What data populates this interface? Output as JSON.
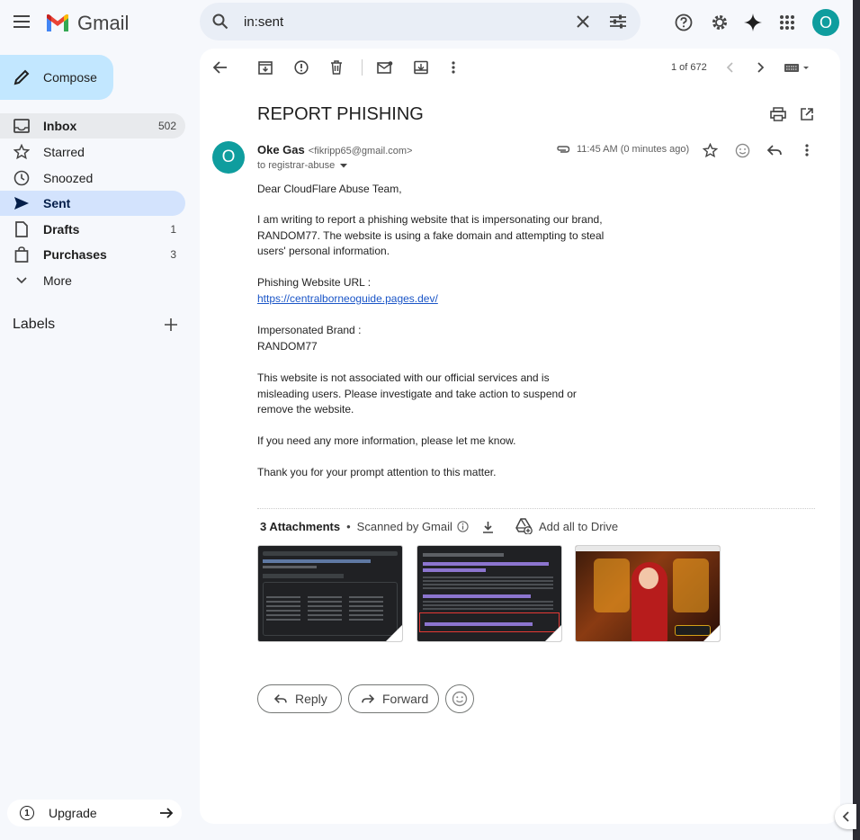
{
  "app": {
    "name": "Gmail",
    "accent": "#0b57d0",
    "avatar_letter": "O",
    "avatar_color": "#0f9d9e"
  },
  "search": {
    "value": "in:sent"
  },
  "compose": {
    "label": "Compose"
  },
  "sidebar": {
    "items": [
      {
        "label": "Inbox",
        "count": "502"
      },
      {
        "label": "Starred",
        "count": ""
      },
      {
        "label": "Snoozed",
        "count": ""
      },
      {
        "label": "Sent",
        "count": ""
      },
      {
        "label": "Drafts",
        "count": "1"
      },
      {
        "label": "Purchases",
        "count": "3"
      },
      {
        "label": "More",
        "count": ""
      }
    ],
    "labels_title": "Labels",
    "upgrade_label": "Upgrade"
  },
  "toolbar": {
    "pagination": "1 of 672"
  },
  "email": {
    "subject": "REPORT PHISHING",
    "sender_name": "Oke Gas",
    "sender_email": "<fikripp65@gmail.com>",
    "to_line": "to registrar-abuse",
    "time": "11:45 AM (0 minutes ago)",
    "greeting": "Dear CloudFlare Abuse Team,",
    "p1": "I am writing to report a phishing website that is impersonating our brand, RANDOM77. The website is using a fake domain and attempting to steal users' personal information.",
    "url_label": "Phishing Website URL :",
    "url": "https://centralborneoguide.pages.dev/",
    "brand_label": "Impersonated Brand :",
    "brand": "RANDOM77",
    "p2": "This website is not associated with our official services and is misleading users. Please investigate and take action to suspend or remove the website.",
    "p3": "If you need any more information, please let me know.",
    "p4": "Thank you for your prompt attention to this matter."
  },
  "attachments": {
    "count_label": "3 Attachments",
    "scanned_label": "Scanned by Gmail",
    "drive_label": "Add all to Drive"
  },
  "actions": {
    "reply_label": "Reply",
    "forward_label": "Forward"
  }
}
